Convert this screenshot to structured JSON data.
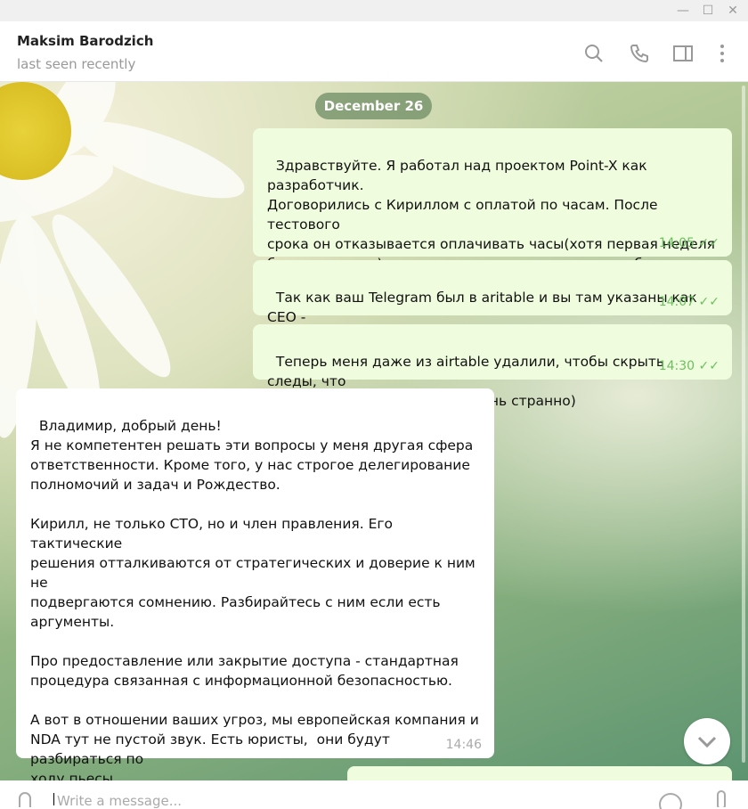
{
  "window": {
    "controls": [
      "minimize",
      "maximize",
      "close"
    ]
  },
  "header": {
    "name": "Maksim Barodzich",
    "status": "last seen recently",
    "icons": [
      "search-icon",
      "phone-icon",
      "sidebar-toggle-icon",
      "more-icon"
    ]
  },
  "chat": {
    "date": "December 26",
    "messages": [
      {
        "dir": "out",
        "text": "Здравствуйте. Я работал над проектом Point-X как разработчик.\nДоговорились с Кириллом с оплатой по часам. После тестового\nсрока он отказывается оплачивать часы(хотя первая неделя\nбыла оплачена), так как он не смог за этот срок убедиться в\nмоей компетентности. Что подскажете делать в данном случае?",
        "time": "14:05",
        "read": true
      },
      {
        "dir": "out",
        "text": "Так как ваш Telegram был в aritable и вы там указаны как CEO -\nрешил написать вам.",
        "time": "14:07",
        "read": true
      },
      {
        "dir": "out",
        "text": "Теперь меня даже из airtable удалили, чтобы скрыть следы, что\nя работал над проектом?) Очень странно)",
        "time": "14:30",
        "read": true
      },
      {
        "dir": "in",
        "text": "Владимир, добрый день!\nЯ не компетентен решать эти вопросы у меня другая сфера\nответственности. Кроме того, у нас строгое делегирование\nполномочий и задач и Рождество.\n\nКирилл, не только СТО, но и член правления. Его тактические\nрешения отталкиваются от стратегических и доверие к ним не\nподвергаются сомнению. Разбирайтесь с ним если есть\nаргументы.\n\nПро предоставление или закрытие доступа - стандартная\nпроцедура связанная с информационной безопасностью.\n\nА вот в отношении ваших угроз, мы европейская компания и\nNDA тут не пустой звук. Есть юристы,  они будут разбираться по\nходу пьесы.\n\nУдачи вам!",
        "time": "14:46"
      }
    ]
  },
  "input": {
    "placeholder": "Write a message..."
  },
  "colors": {
    "outgoing_bubble": "#effdde",
    "check": "#6cbf5e",
    "accent": "#40a7e3"
  }
}
